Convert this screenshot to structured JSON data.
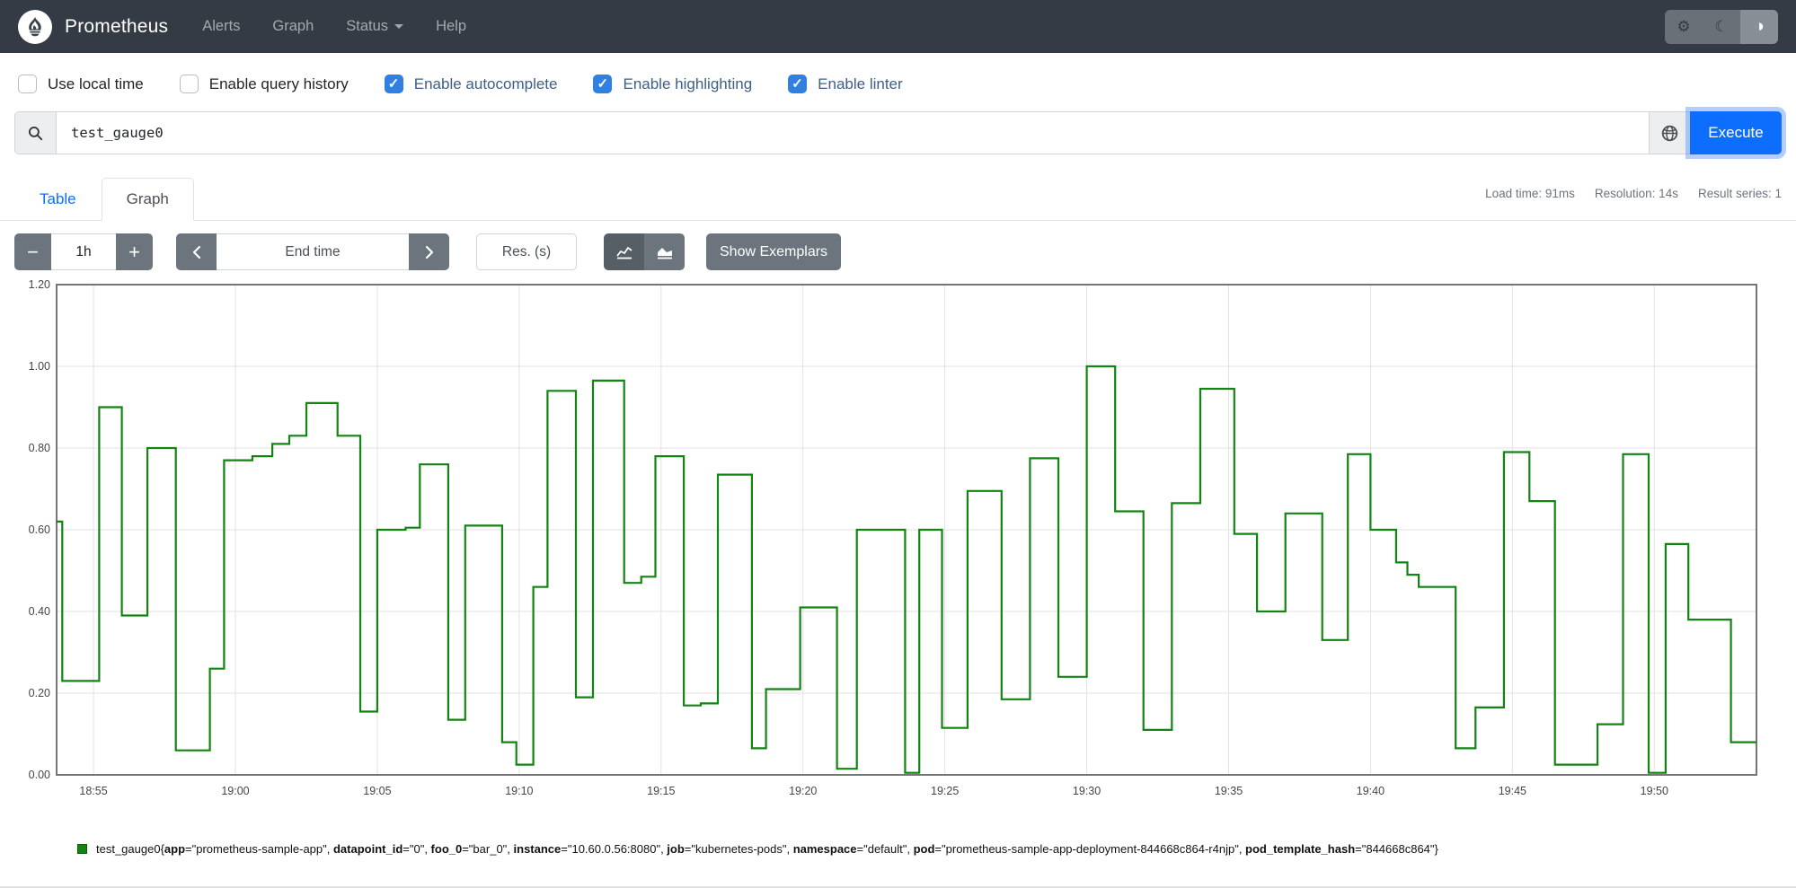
{
  "navbar": {
    "brand": "Prometheus",
    "items": [
      {
        "label": "Alerts"
      },
      {
        "label": "Graph"
      },
      {
        "label": "Status"
      },
      {
        "label": "Help"
      }
    ],
    "theme": {
      "light_icon": "gear",
      "dark_icon": "moon",
      "auto_icon": "contrast",
      "active": "auto"
    }
  },
  "options": [
    {
      "label": "Use local time",
      "checked": false
    },
    {
      "label": "Enable query history",
      "checked": false
    },
    {
      "label": "Enable autocomplete",
      "checked": true
    },
    {
      "label": "Enable highlighting",
      "checked": true
    },
    {
      "label": "Enable linter",
      "checked": true
    }
  ],
  "query": {
    "value": "test_gauge0",
    "execute_label": "Execute"
  },
  "stats": {
    "load_time": "Load time: 91ms",
    "resolution": "Resolution: 14s",
    "result_series": "Result series: 1"
  },
  "tabs": [
    {
      "label": "Table",
      "active": false
    },
    {
      "label": "Graph",
      "active": true
    }
  ],
  "controls": {
    "minus": "−",
    "duration": "1h",
    "plus": "+",
    "end_time_placeholder": "End time",
    "res_placeholder": "Res. (s)",
    "show_exemplars": "Show Exemplars"
  },
  "chart_data": {
    "type": "line",
    "step": true,
    "grid": true,
    "line_color": "#128412",
    "ylim": [
      0,
      1.2
    ],
    "y_ticks": [
      "0.00",
      "0.20",
      "0.40",
      "0.60",
      "0.80",
      "1.00",
      "1.20"
    ],
    "x_tick_labels": [
      "18:55",
      "19:00",
      "19:05",
      "19:10",
      "19:15",
      "19:20",
      "19:25",
      "19:30",
      "19:35",
      "19:40",
      "19:45",
      "19:50"
    ],
    "x_tick_minutes": [
      0,
      5,
      10,
      15,
      20,
      25,
      30,
      35,
      40,
      45,
      50,
      55
    ],
    "xlim_minutes": [
      -1.3,
      58.6
    ],
    "series_name": "test_gauge0",
    "points_t_minutes_after_1855_v": [
      [
        -1.3,
        0.62
      ],
      [
        -1.1,
        0.23
      ],
      [
        0.2,
        0.9
      ],
      [
        1.0,
        0.39
      ],
      [
        1.9,
        0.8
      ],
      [
        2.9,
        0.06
      ],
      [
        4.1,
        0.26
      ],
      [
        4.6,
        0.77
      ],
      [
        5.6,
        0.78
      ],
      [
        6.3,
        0.81
      ],
      [
        6.9,
        0.83
      ],
      [
        7.5,
        0.91
      ],
      [
        8.6,
        0.83
      ],
      [
        9.4,
        0.155
      ],
      [
        10.0,
        0.6
      ],
      [
        11.0,
        0.605
      ],
      [
        11.5,
        0.76
      ],
      [
        12.5,
        0.135
      ],
      [
        13.1,
        0.61
      ],
      [
        14.4,
        0.08
      ],
      [
        14.9,
        0.025
      ],
      [
        15.5,
        0.46
      ],
      [
        16.0,
        0.94
      ],
      [
        17.0,
        0.19
      ],
      [
        17.6,
        0.965
      ],
      [
        18.7,
        0.47
      ],
      [
        19.3,
        0.485
      ],
      [
        19.8,
        0.78
      ],
      [
        20.8,
        0.17
      ],
      [
        21.4,
        0.175
      ],
      [
        22.0,
        0.735
      ],
      [
        23.2,
        0.065
      ],
      [
        23.7,
        0.21
      ],
      [
        24.9,
        0.41
      ],
      [
        26.2,
        0.015
      ],
      [
        26.9,
        0.6
      ],
      [
        28.6,
        0.005
      ],
      [
        29.1,
        0.6
      ],
      [
        29.9,
        0.115
      ],
      [
        30.8,
        0.695
      ],
      [
        32.0,
        0.185
      ],
      [
        33.0,
        0.775
      ],
      [
        34.0,
        0.24
      ],
      [
        35.0,
        1.0
      ],
      [
        36.0,
        0.645
      ],
      [
        37.0,
        0.11
      ],
      [
        38.0,
        0.665
      ],
      [
        39.0,
        0.945
      ],
      [
        40.2,
        0.59
      ],
      [
        41.0,
        0.4
      ],
      [
        42.0,
        0.64
      ],
      [
        43.3,
        0.33
      ],
      [
        44.2,
        0.785
      ],
      [
        45.0,
        0.6
      ],
      [
        45.9,
        0.52
      ],
      [
        46.3,
        0.49
      ],
      [
        46.7,
        0.46
      ],
      [
        48.0,
        0.065
      ],
      [
        48.7,
        0.165
      ],
      [
        49.7,
        0.79
      ],
      [
        50.6,
        0.67
      ],
      [
        51.5,
        0.025
      ],
      [
        53.0,
        0.124
      ],
      [
        53.9,
        0.785
      ],
      [
        54.8,
        0.005
      ],
      [
        55.4,
        0.565
      ],
      [
        56.2,
        0.38
      ],
      [
        57.7,
        0.08
      ]
    ]
  },
  "legend": {
    "metric": "test_gauge0",
    "labels": [
      [
        "app",
        "prometheus-sample-app"
      ],
      [
        "datapoint_id",
        "0"
      ],
      [
        "foo_0",
        "bar_0"
      ],
      [
        "instance",
        "10.60.0.56:8080"
      ],
      [
        "job",
        "kubernetes-pods"
      ],
      [
        "namespace",
        "default"
      ],
      [
        "pod",
        "prometheus-sample-app-deployment-844668c864-r4njp"
      ],
      [
        "pod_template_hash",
        "844668c864"
      ]
    ],
    "swatch_color": "#128412"
  }
}
